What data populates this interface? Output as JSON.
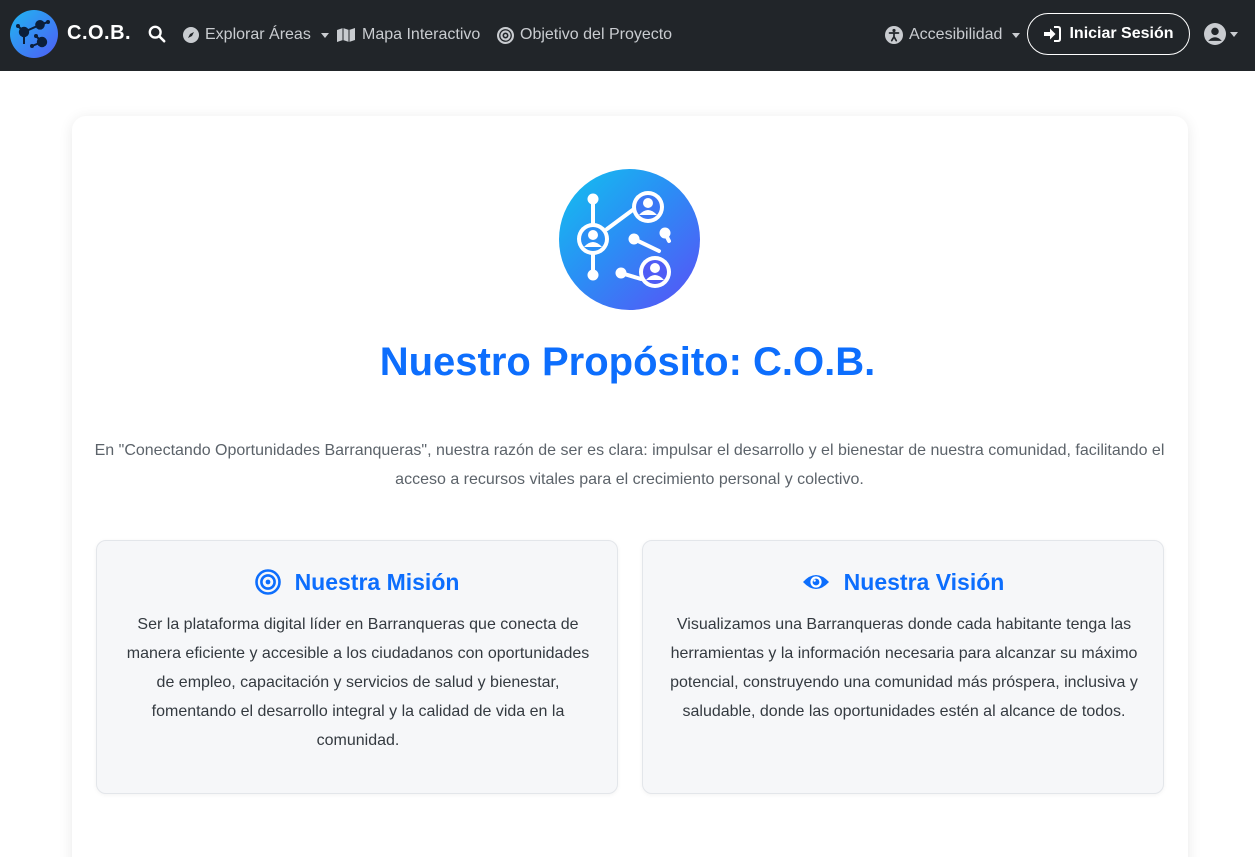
{
  "nav": {
    "brand": "C.O.B.",
    "links": [
      {
        "label": "Explorar Áreas"
      },
      {
        "label": "Mapa Interactivo"
      },
      {
        "label": "Objetivo del Proyecto"
      }
    ],
    "accessibility": "Accesibilidad",
    "login": "Iniciar Sesión"
  },
  "hero": {
    "title": "Nuestro Propósito: C.O.B.",
    "intro": "En \"Conectando Oportunidades Barranqueras\", nuestra razón de ser es clara: impulsar el desarrollo y el bienestar de nuestra comunidad, facilitando el acceso a recursos vitales para el crecimiento personal y colectivo."
  },
  "mission": {
    "title": "Nuestra Misión",
    "text": "Ser la plataforma digital líder en Barranqueras que conecta de manera eficiente y accesible a los ciudadanos con oportunidades de empleo, capacitación y servicios de salud y bienestar, fomentando el desarrollo integral y la calidad de vida en la comunidad."
  },
  "vision": {
    "title": "Nuestra Visión",
    "text": "Visualizamos una Barranqueras donde cada habitante tenga las herramientas y la información necesaria para alcanzar su máximo potencial, construyendo una comunidad más próspera, inclusiva y saludable, donde las oportunidades estén al alcance de todos."
  },
  "colors": {
    "navbar": "#212529",
    "accent": "#0d6efd",
    "logo_gradient_start": "#12c2ee",
    "logo_gradient_end": "#5a4ff6"
  },
  "icons": {
    "logo": "network-people-icon",
    "search": "search-icon",
    "explore": "compass-icon",
    "map": "map-icon",
    "objective": "bullseye-icon",
    "accessibility": "universal-access-icon",
    "login": "sign-in-icon",
    "user": "user-circle-icon",
    "mission": "bullseye-icon",
    "vision": "eye-icon"
  }
}
